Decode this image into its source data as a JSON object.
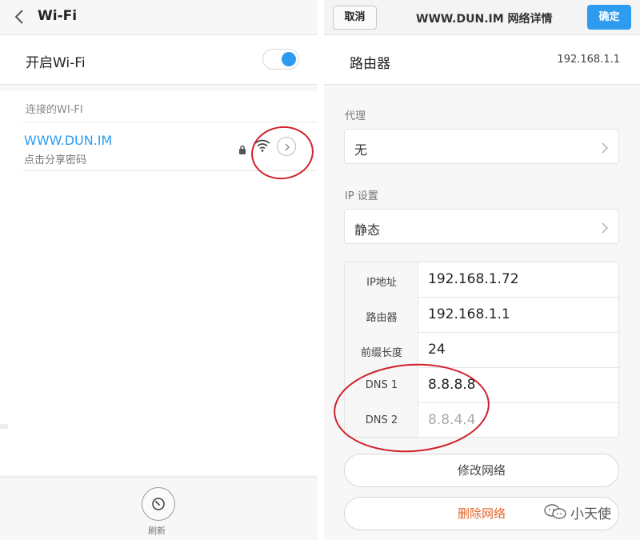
{
  "left": {
    "header": {
      "title": "Wi-Fi"
    },
    "wifi_toggle": {
      "label": "开启Wi-Fi",
      "on": true
    },
    "section_label": "连接的WI-FI",
    "network": {
      "name": "WWW.DUN.IM",
      "subtitle": "点击分享密码"
    },
    "refresh_label": "刷新"
  },
  "right": {
    "header": {
      "cancel_label": "取消",
      "title": "WWW.DUN.IM 网络详情",
      "ok_label": "确定"
    },
    "router": {
      "label": "路由器",
      "value": "192.168.1.1"
    },
    "proxy": {
      "label": "代理",
      "value": "无"
    },
    "ip_settings": {
      "label": "IP 设置",
      "value": "静态"
    },
    "ip_table": [
      {
        "key": "IP地址",
        "value": "192.168.1.72"
      },
      {
        "key": "路由器",
        "value": "192.168.1.1"
      },
      {
        "key": "前缀长度",
        "value": "24"
      },
      {
        "key": "DNS 1",
        "value": "8.8.8.8"
      },
      {
        "key": "DNS 2",
        "value": "8.8.4.4"
      }
    ],
    "modify_label": "修改网络",
    "delete_label": "删除网络"
  },
  "watermark": {
    "text": "小天使"
  },
  "colors": {
    "accent": "#2d9cf0",
    "danger": "#e5622a",
    "annotation": "#d0202a"
  }
}
